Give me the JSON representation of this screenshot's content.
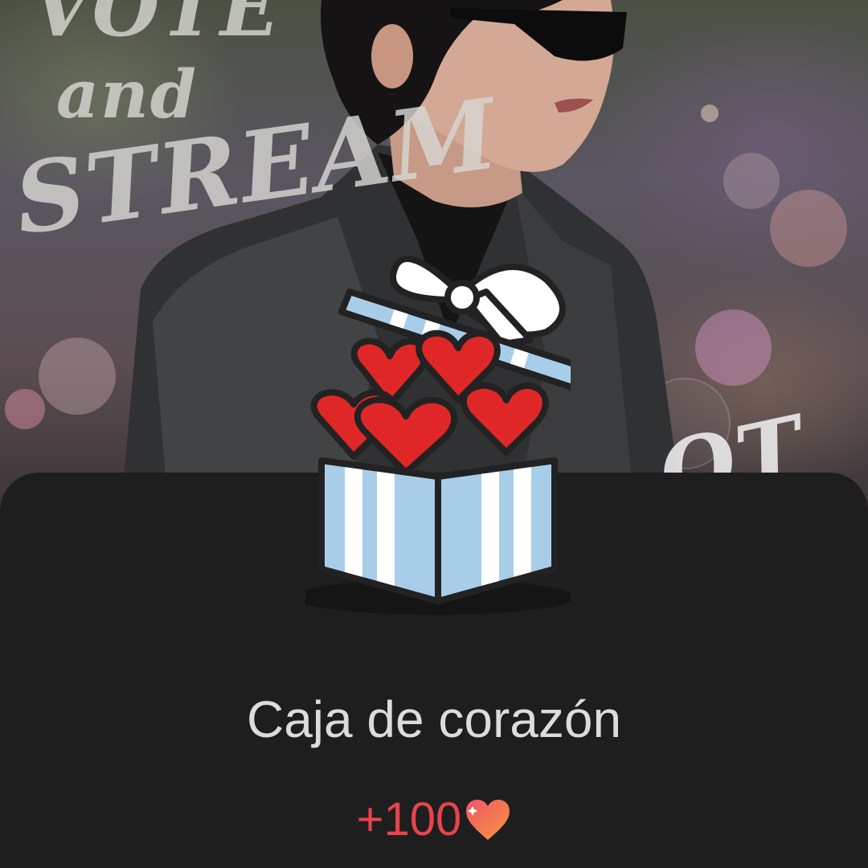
{
  "background": {
    "overlay_words": [
      "VOTE",
      "and",
      "STREAM",
      "OT"
    ]
  },
  "gift_card": {
    "icon": "gift-box-hearts-icon",
    "title": "Caja de corazón",
    "reward_amount": "+100",
    "reward_icon": "heart-icon",
    "accent_color": "#e8434c",
    "sheet_color": "#1e1e1e",
    "box_color": "#a8cde8",
    "heart_color": "#e02727"
  }
}
